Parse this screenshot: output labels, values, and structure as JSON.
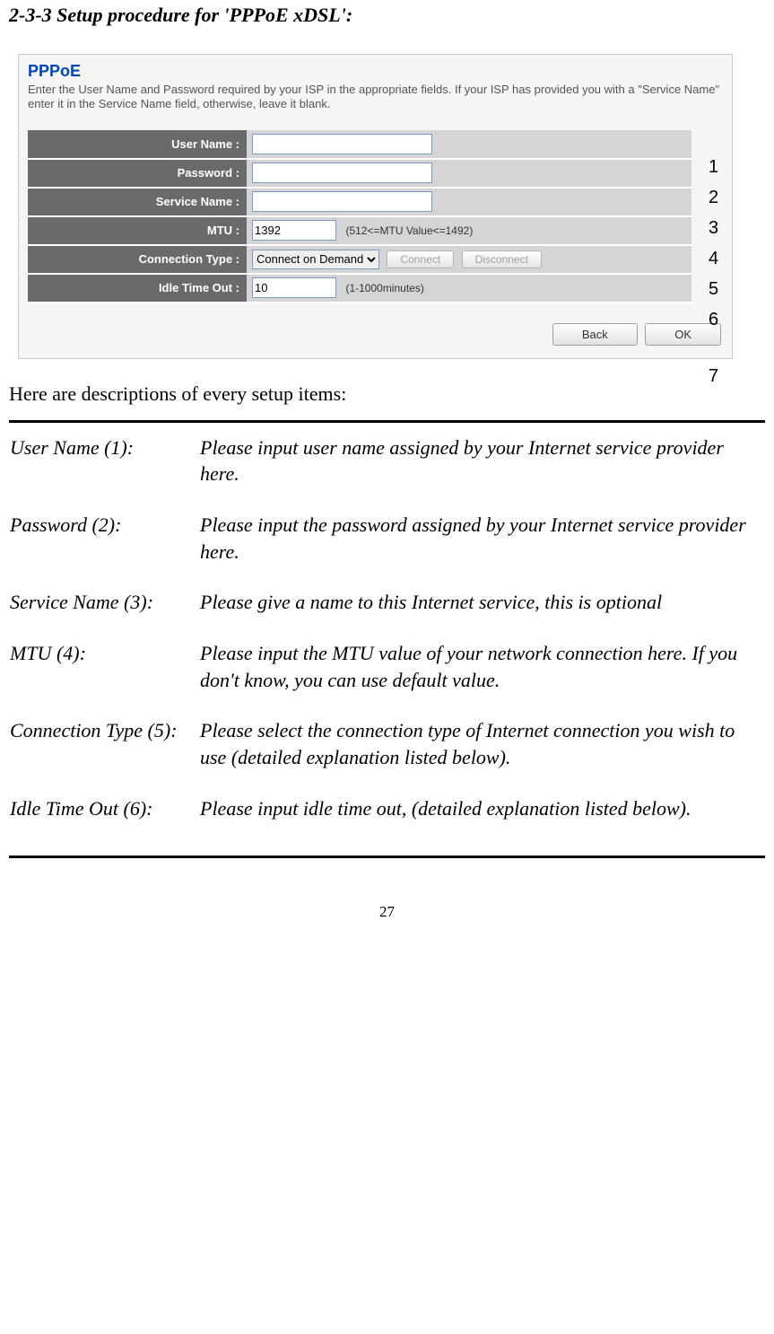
{
  "section_title": "2-3-3 Setup procedure for 'PPPoE xDSL':",
  "screenshot": {
    "title": "PPPoE",
    "description": "Enter the User Name and Password required by your ISP in the appropriate fields. If your ISP has provided you with a \"Service Name\" enter it in the Service Name field, otherwise, leave it blank.",
    "rows": {
      "username_label": "User Name :",
      "username_value": "",
      "password_label": "Password :",
      "password_value": "",
      "servicename_label": "Service Name :",
      "servicename_value": "",
      "mtu_label": "MTU :",
      "mtu_value": "1392",
      "mtu_hint": "(512<=MTU Value<=1492)",
      "conntype_label": "Connection Type :",
      "conntype_value": "Connect on Demand",
      "connect_btn": "Connect",
      "disconnect_btn": "Disconnect",
      "idle_label": "Idle Time Out :",
      "idle_value": "10",
      "idle_hint": "(1-1000minutes)"
    },
    "buttons": {
      "back": "Back",
      "ok": "OK"
    }
  },
  "annotations": [
    "1",
    "2",
    "3",
    "4",
    "5",
    "6"
  ],
  "annotation_7": "7",
  "descriptions_intro": "Here are descriptions of every setup items:",
  "descriptions": [
    {
      "label": "User Name (1):",
      "text": "Please input user name assigned by your Internet service provider here."
    },
    {
      "label": "Password (2):",
      "text": "Please input the password assigned by your Internet service provider here."
    },
    {
      "label": "Service Name (3):",
      "text": "Please give a name to this Internet service, this is optional"
    },
    {
      "label": "MTU (4):",
      "text": "Please input the MTU value of your network connection here. If you don't know, you can use default value."
    },
    {
      "label": "Connection Type (5):",
      "text": "Please select the connection type of Internet connection you wish to use (detailed explanation listed below)."
    },
    {
      "label": "Idle Time Out (6):",
      "text": "Please input idle time out, (detailed explanation listed below)."
    }
  ],
  "page_number": "27"
}
